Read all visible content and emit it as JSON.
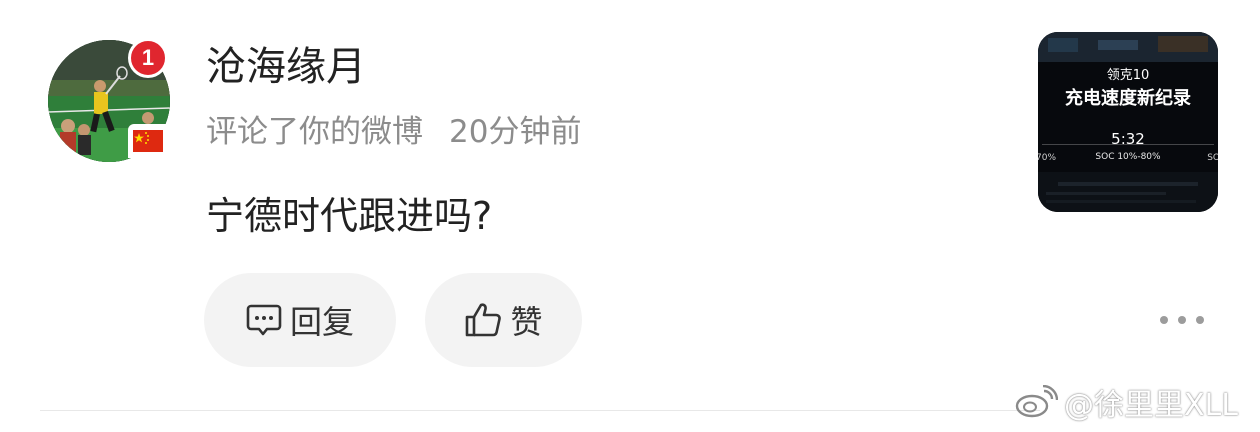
{
  "comment_card": {
    "username": "沧海缘月",
    "action_text": "评论了你的微博",
    "time_ago": "20分钟前",
    "comment_text": "宁德时代跟进吗?",
    "avatar_badge": "1",
    "reply_label": "回复",
    "like_label": "赞"
  },
  "thumbnail": {
    "brand": "领克10",
    "title": "充电速度新纪录",
    "time": "5:32",
    "soc": "SOC 10%-80%",
    "left_edge": "70%",
    "right_edge": "SO"
  },
  "watermark": {
    "text": "@徐里里XLL",
    "icon": "weibo-logo-icon"
  },
  "icons": {
    "reply": "comment-bubble-icon",
    "like": "thumbs-up-icon",
    "more": "more-dots-icon",
    "flag": "china-flag-icon"
  },
  "colors": {
    "badge": "#e0262f",
    "pill_bg": "#f3f3f3",
    "secondary_text": "#8c8c8c",
    "primary_text": "#222222"
  }
}
